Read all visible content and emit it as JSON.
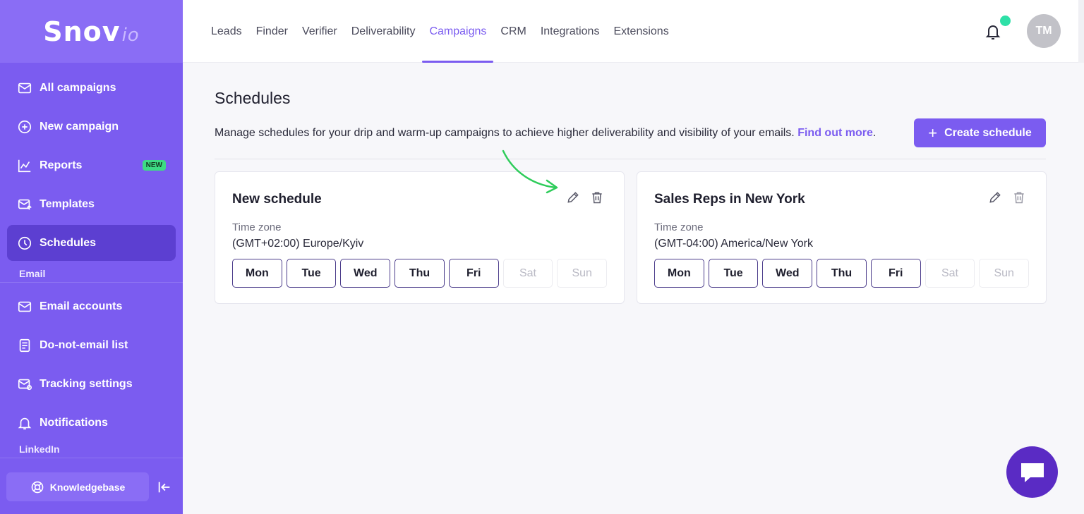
{
  "sidebar": {
    "logo": {
      "main": "Snov",
      "suffix": "io"
    },
    "items": [
      {
        "label": "All campaigns",
        "icon": "mail-icon"
      },
      {
        "label": "New campaign",
        "icon": "plus-circle-icon"
      },
      {
        "label": "Reports",
        "icon": "chart-icon",
        "badge": "NEW"
      },
      {
        "label": "Templates",
        "icon": "template-icon"
      },
      {
        "label": "Schedules",
        "icon": "clock-icon",
        "active": true
      }
    ],
    "email_section_label": "Email",
    "email_items": [
      {
        "label": "Email accounts",
        "icon": "mail-icon"
      },
      {
        "label": "Do-not-email list",
        "icon": "document-icon"
      },
      {
        "label": "Tracking settings",
        "icon": "mail-settings-icon"
      },
      {
        "label": "Notifications",
        "icon": "bell-icon"
      }
    ],
    "linkedin_section_label": "LinkedIn",
    "knowledgebase_label": "Knowledgebase"
  },
  "topnav": {
    "items": [
      "Leads",
      "Finder",
      "Verifier",
      "Deliverability",
      "Campaigns",
      "CRM",
      "Integrations",
      "Extensions"
    ],
    "active": "Campaigns",
    "avatar_initials": "TM"
  },
  "main": {
    "title": "Schedules",
    "description": "Manage schedules for your drip and warm-up campaigns to achieve higher deliverability and visibility of your emails.",
    "description_link": "Find out more",
    "description_end": ".",
    "create_button": "Create schedule",
    "timezone_label": "Time zone",
    "schedules": [
      {
        "name": "New schedule",
        "timezone": "(GMT+02:00) Europe/Kyiv",
        "days": [
          {
            "label": "Mon",
            "on": true
          },
          {
            "label": "Tue",
            "on": true
          },
          {
            "label": "Wed",
            "on": true
          },
          {
            "label": "Thu",
            "on": true
          },
          {
            "label": "Fri",
            "on": true
          },
          {
            "label": "Sat",
            "on": false
          },
          {
            "label": "Sun",
            "on": false
          }
        ]
      },
      {
        "name": "Sales Reps in New York",
        "timezone": "(GMT-04:00) America/New York",
        "days": [
          {
            "label": "Mon",
            "on": true
          },
          {
            "label": "Tue",
            "on": true
          },
          {
            "label": "Wed",
            "on": true
          },
          {
            "label": "Thu",
            "on": true
          },
          {
            "label": "Fri",
            "on": true
          },
          {
            "label": "Sat",
            "on": false
          },
          {
            "label": "Sun",
            "on": false
          }
        ]
      }
    ]
  },
  "colors": {
    "accent": "#7b5cf0",
    "sidebar_active": "#5c3fd1",
    "badge": "#3ddc84",
    "notification_dot": "#2ee0a7",
    "annotation_arrow": "#2ecc5a",
    "chat": "#5a2bc4"
  }
}
